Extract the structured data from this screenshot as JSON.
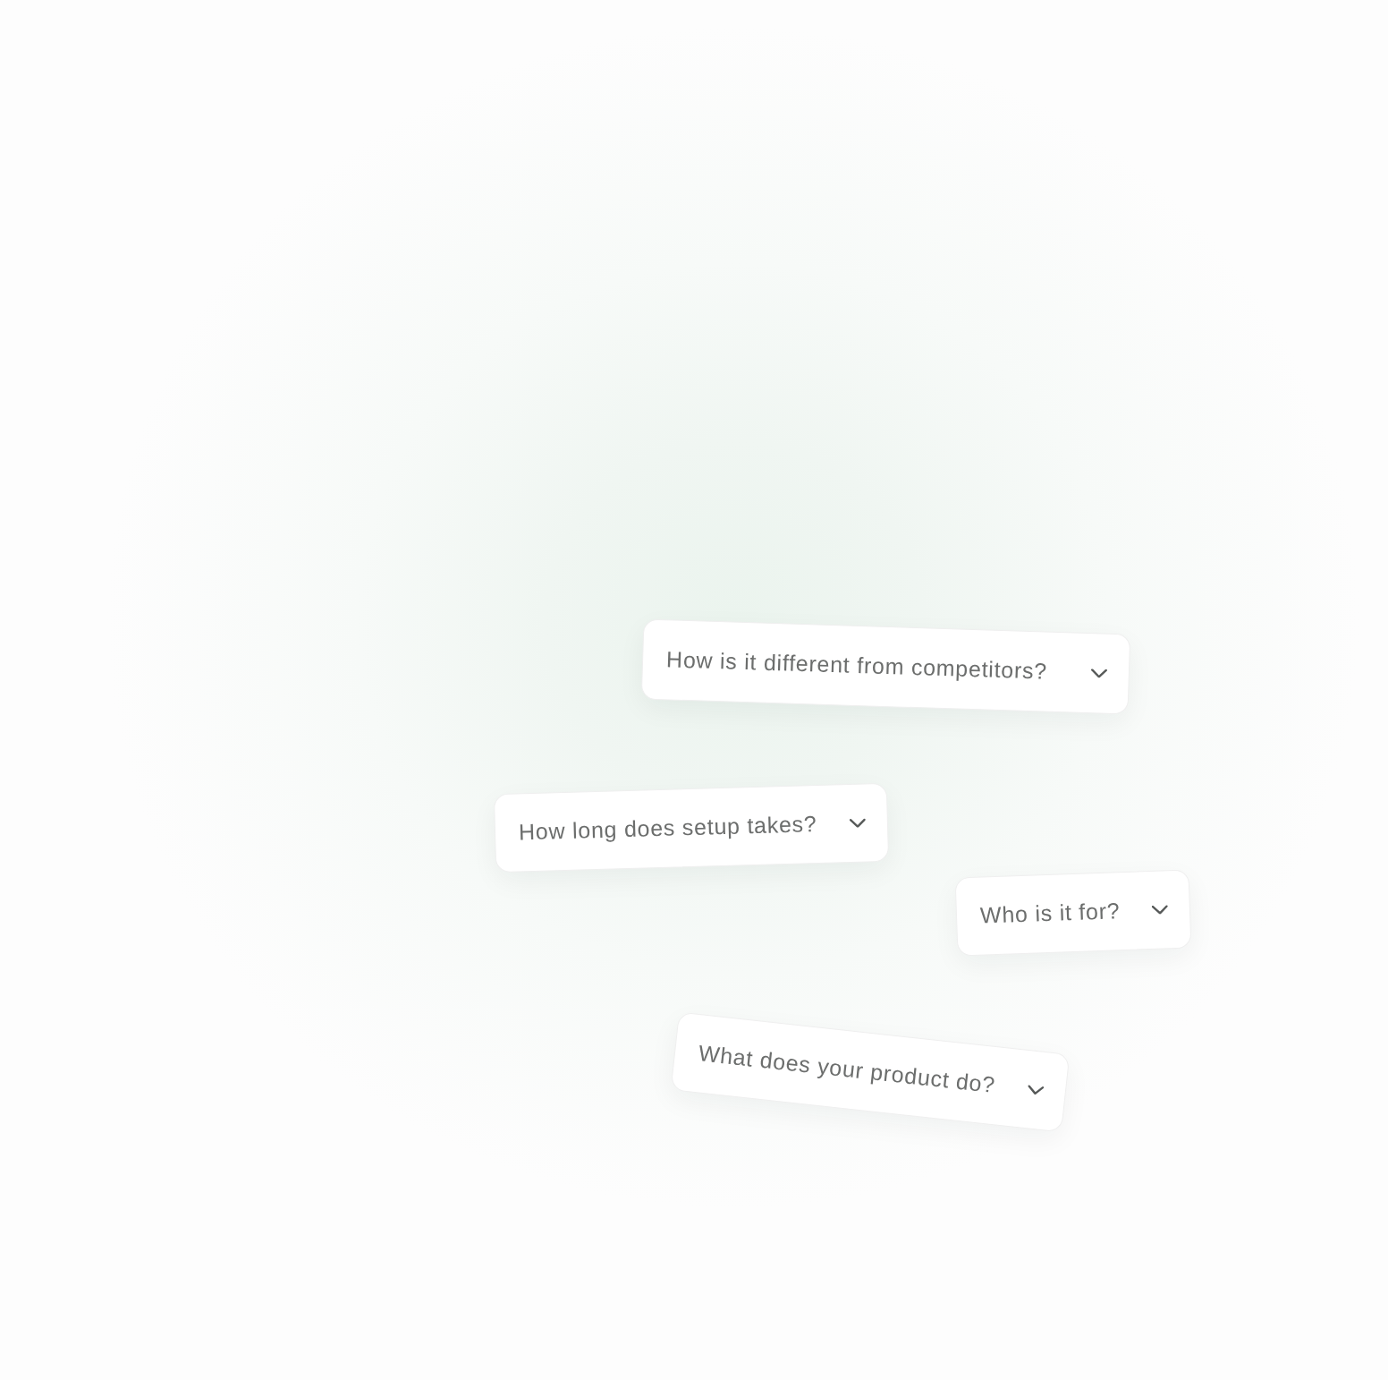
{
  "faq_items": [
    {
      "question": "How is it different from competitors?",
      "expanded": false
    },
    {
      "question": "How long does setup takes?",
      "expanded": false
    },
    {
      "question": "Who is it for?",
      "expanded": false
    },
    {
      "question": "What does your product do?",
      "expanded": false
    }
  ]
}
